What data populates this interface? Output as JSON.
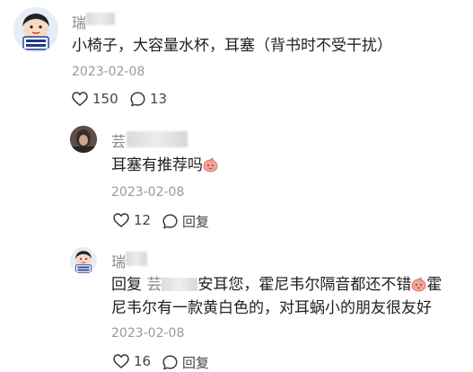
{
  "main_comment": {
    "username": "瑞",
    "text": "小椅子，大容量水杯，耳塞（背书时不受干扰）",
    "date": "2023-02-08",
    "like_count": "150",
    "reply_count": "13",
    "avatar_badge_text": "我们 继续上岸"
  },
  "reply_1": {
    "username": "芸",
    "text": "耳塞有推荐吗",
    "date": "2023-02-08",
    "like_count": "12",
    "reply_label": "回复"
  },
  "reply_2": {
    "username": "瑞",
    "line1_prefix": "回复",
    "line1_mention": "芸",
    "line1_rest": "安耳您，霍尼韦尔隔音都还不错",
    "line1_suffix": "霍",
    "line2": "尼韦尔有一款黄白色的，对耳蜗小的朋友很友好",
    "date": "2023-02-08",
    "like_count": "16",
    "reply_label": "回复",
    "avatar_badge_text": "我们 继续上岸"
  },
  "icons": {
    "like": "heart-outline-icon",
    "reply": "speech-bubble-icon",
    "emoji": "peach-face-emoji-icon"
  },
  "colors": {
    "text_primary": "#1f1f1f",
    "text_secondary": "#9a9a9a",
    "username": "#888888",
    "emoji_peach": "#f28b82"
  }
}
